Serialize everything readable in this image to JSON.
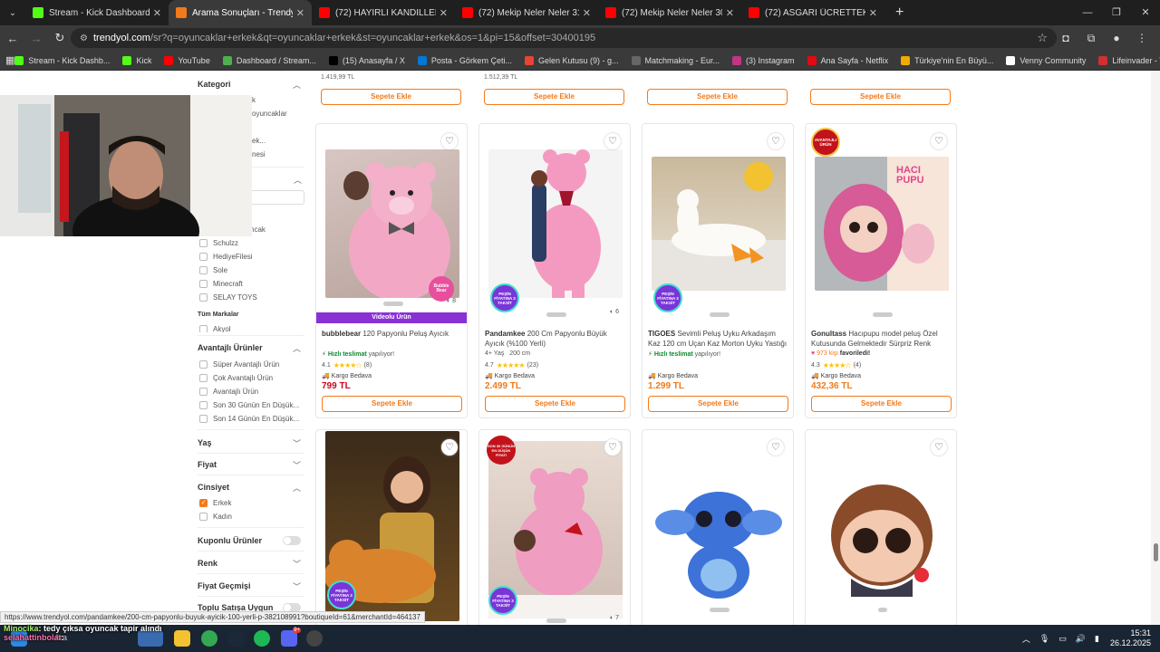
{
  "browser": {
    "tabs": [
      {
        "title": "Stream - Kick Dashboard",
        "color": "#53fc18",
        "active": false
      },
      {
        "title": "Arama Sonuçları - Trendyol - Sa",
        "color": "#f27a1a",
        "active": true
      },
      {
        "title": "(72) HAYIRLI KANDİLLER | Mad",
        "color": "#ff0000",
        "active": false
      },
      {
        "title": "(72) Mekip Neler Neler 31.Bölü",
        "color": "#ff0000",
        "active": false
      },
      {
        "title": "(72) Mekip Neler Neler 30.bölü",
        "color": "#ff0000",
        "active": false
      },
      {
        "title": "(72) ASGARİ ÜCRETTEKİ 50 KU",
        "color": "#ff0000",
        "active": false
      }
    ],
    "url_host": "trendyol.com",
    "url_rest": "/sr?q=oyuncaklar+erkek&qt=oyuncaklar+erkek&st=oyuncaklar+erkek&os=1&pi=15&offset=30400195",
    "bookmarks": [
      {
        "label": "Stream - Kick Dashb...",
        "color": "#53fc18"
      },
      {
        "label": "Kick",
        "color": "#53fc18"
      },
      {
        "label": "YouTube",
        "color": "#ff0000"
      },
      {
        "label": "Dashboard / Stream...",
        "color": "#4caf50"
      },
      {
        "label": "(15) Anasayfa / X",
        "color": "#000000"
      },
      {
        "label": "Posta - Görkem Çeti...",
        "color": "#0078d4"
      },
      {
        "label": "Gelen Kutusu (9) - g...",
        "color": "#ea4335"
      },
      {
        "label": "Matchmaking - Eur...",
        "color": "#666666"
      },
      {
        "label": "(3) Instagram",
        "color": "#c13584"
      },
      {
        "label": "Ana Sayfa - Netflix",
        "color": "#e50914"
      },
      {
        "label": "Türkiye'nin En Büyü...",
        "color": "#f2a900"
      },
      {
        "label": "Venny Community",
        "color": "#ffffff"
      },
      {
        "label": "Lifeinvader - VennyV",
        "color": "#d32f2f"
      }
    ]
  },
  "sidebar": {
    "kategori": "Kategori",
    "kat_items": [
      "k",
      "oyuncaklar",
      "ek...",
      "nesi"
    ],
    "brands": [
      "ncak",
      "Schulzz",
      "HediyeFilesi",
      "Sole",
      "Minecraft",
      "SELAY TOYS"
    ],
    "tum_markalar": "Tüm Markalar",
    "partial_brand": "Akyol",
    "avantajli_title": "Avantajlı Ürünler",
    "avantajli_items": [
      "Süper Avantajlı Ürün",
      "Çok Avantajlı Ürün",
      "Avantajlı Ürün",
      "Son 30 Günün En Düşük...",
      "Son 14 Günün En Düşük..."
    ],
    "yas": "Yaş",
    "fiyat": "Fiyat",
    "cinsiyet": "Cinsiyet",
    "gender_items": [
      {
        "label": "Erkek",
        "checked": true
      },
      {
        "label": "Kadın",
        "checked": false
      }
    ],
    "kuponlu": "Kuponlu Ürünler",
    "renk": "Renk",
    "fiyat_gecmisi": "Fiyat Geçmişi",
    "toplu": "Toplu Satışa Uygun"
  },
  "top_row": {
    "prices": [
      "1.419,99 TL",
      "1.512,39 TL"
    ],
    "button": "Sepete Ekle"
  },
  "products": [
    {
      "brand": "bubblebear",
      "name": "120 Papyonlu Peluş Ayıcık",
      "photos": "8",
      "video": "Videolu Ürün",
      "fast": "Hızlı teslimat",
      "fast_tail": "yapılıyor!",
      "rating": "4.1",
      "stars": "★★★★☆",
      "reviews": "(8)",
      "cargo": "Kargo Bedava",
      "price": "799 TL",
      "price_red": true,
      "button": "Sepete Ekle",
      "badge_text": "Bubble Bear"
    },
    {
      "brand": "Pandamkee",
      "name": "200 Cm Papyonlu Büyük Ayıcık (%100 Yerli)",
      "photos": "6",
      "age": "4+ Yaş",
      "size": "200 cm",
      "rating": "4.7",
      "stars": "★★★★★",
      "reviews": "(23)",
      "cargo": "Kargo Bedava",
      "price": "2.499 TL",
      "price_red": false,
      "button": "Sepete Ekle",
      "badge_text": "PEŞİN FİYATINA 3 TAKSİT"
    },
    {
      "brand": "TIGOES",
      "name": "Sevimli Peluş Uyku Arkadaşım Kaz 120 cm Uçan Kaz Morton Uyku Yastığı",
      "fast": "Hızlı teslimat",
      "fast_tail": "yapılıyor!",
      "cargo": "Kargo Bedava",
      "price": "1.299 TL",
      "price_red": false,
      "button": "Sepete Ekle",
      "badge_text": "PEŞİN FİYATINA 3 TAKSİT"
    },
    {
      "brand": "Gonultass",
      "name": "Hacıpupu model peluş Özel Kutusunda Gelmektedir Sürpriz Renk",
      "fav_count": "973 kişi",
      "fav_tail": "favoriledi!",
      "rating": "4.3",
      "stars": "★★★★☆",
      "reviews": "(4)",
      "cargo": "Kargo Bedava",
      "price": "432,36 TL",
      "price_red": false,
      "button": "Sepete Ekle",
      "badge_text": "AVANTAJLI ÜRÜN",
      "box_text": "HACI PUPU"
    }
  ],
  "bottom_row": {
    "photos_2": "7",
    "badge_son30": "SON 30 GÜNÜN EN DÜŞÜK FİYATI",
    "badge_pesin": "PEŞİN FİYATINA 3 TAKSİT"
  },
  "status_url": "https://www.trendyol.com/pandamkee/200-cm-papyonlu-buyuk-ayicik-100-yerli-p-382108991?boutiqueId=61&merchantId=464137",
  "chat": {
    "user1": "Minocika",
    "msg1": ": tedy çıksa oyuncak tapir alındı",
    "user2": "selahattinbolat",
    "msg2": ":"
  },
  "taskbar": {
    "time": "15:31",
    "date": "26.12.2025",
    "search_label": "Ara",
    "discord_badge": "9+"
  }
}
